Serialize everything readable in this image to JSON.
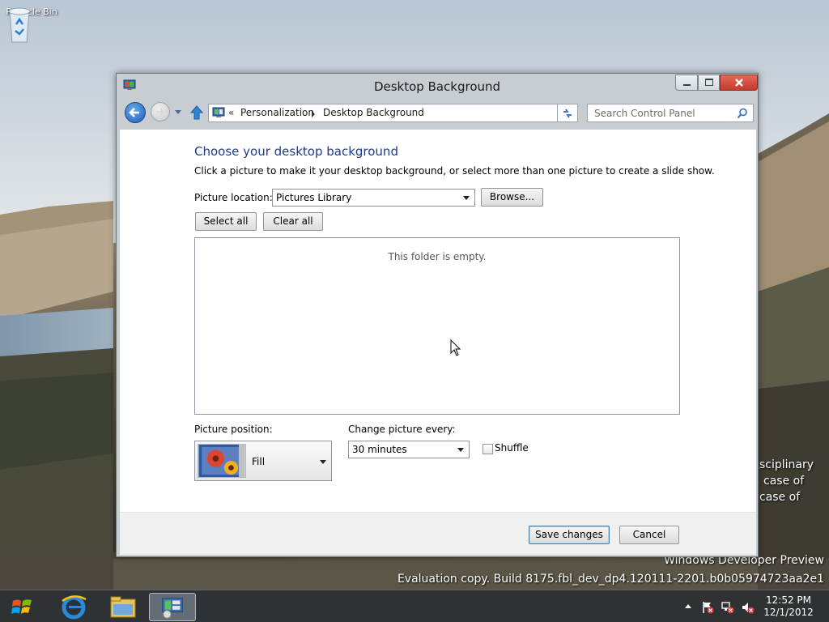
{
  "desktop": {
    "icons": [
      {
        "label": "Recycle Bin",
        "icon": "recycle-bin-icon"
      }
    ],
    "watermark_line1": "Windows Developer Preview",
    "watermark_line2": "Evaluation copy. Build 8175.fbl_dev_dp4.120111-2201.b0b05974723aa2e1",
    "behind_window_text": [
      "sciplinary",
      "case of",
      "case of"
    ]
  },
  "window": {
    "title": "Desktop Background",
    "controls": {
      "minimize": "minimize-icon",
      "maximize": "maximize-icon",
      "close": "close-icon"
    },
    "navigation": {
      "breadcrumb_overflow": "«",
      "breadcrumbs": [
        "Personalization",
        "Desktop Background"
      ],
      "search_placeholder": "Search Control Panel"
    },
    "content": {
      "heading": "Choose your desktop background",
      "description": "Click a picture to make it your desktop background, or select more than one picture to create a slide show.",
      "picture_location_label": "Picture location:",
      "picture_location_value": "Pictures Library",
      "browse_label": "Browse...",
      "select_all_label": "Select all",
      "clear_all_label": "Clear all",
      "empty_message": "This folder is empty.",
      "picture_position_label": "Picture position:",
      "picture_position_value": "Fill",
      "change_picture_label": "Change picture every:",
      "change_picture_value": "30 minutes",
      "shuffle_label": "Shuffle",
      "shuffle_checked": false
    },
    "footer": {
      "save_label": "Save changes",
      "cancel_label": "Cancel"
    }
  },
  "taskbar": {
    "items": [
      "start-orb-icon",
      "internet-explorer-icon",
      "file-explorer-icon",
      "control-panel-icon"
    ],
    "active_item": "control-panel-icon",
    "tray_icons": [
      "action-center-icon",
      "network-icon",
      "volume-muted-icon"
    ],
    "time": "12:52 PM",
    "date": "12/1/2012"
  },
  "colors": {
    "heading": "#1e3a8a",
    "close_button": "#c6392a",
    "taskbar": "#282e34"
  }
}
